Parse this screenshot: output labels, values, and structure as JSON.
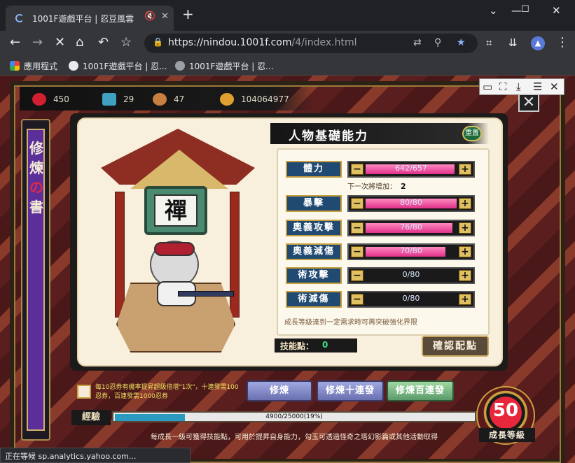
{
  "browser": {
    "tab_title": "1001F遊戲平台 | 忍豆風雲",
    "url_host": "https://nindou.1001f.com",
    "url_path": "/4/index.html",
    "status_text": "正在等候 sp.analytics.yahoo.com...",
    "bookmarks": [
      {
        "label": "應用程式"
      },
      {
        "label": "1001F遊戲平台 | 忍..."
      },
      {
        "label": "1001F遊戲平台 | 忍..."
      }
    ]
  },
  "game": {
    "resources": [
      {
        "icon": "heart-icon",
        "value": "450",
        "color": "#d02030"
      },
      {
        "icon": "card-icon",
        "value": "29",
        "color": "#40a0c0"
      },
      {
        "icon": "bread-icon",
        "value": "47",
        "color": "#c88040"
      },
      {
        "icon": "coin-icon",
        "value": "104064977",
        "color": "#e0a030"
      }
    ],
    "scroll_title": [
      "修",
      "煉",
      "の",
      "書"
    ],
    "shrine_sign": "禪",
    "stats_title": "人物基礎能力",
    "reset_label": "重置",
    "stats": [
      {
        "label": "體力",
        "value": "642/657",
        "fill": 0.977
      },
      {
        "label": "暴擊",
        "value": "80/80",
        "fill": 1.0
      },
      {
        "label": "奧義攻擊",
        "value": "76/80",
        "fill": 0.95
      },
      {
        "label": "奧義減傷",
        "value": "70/80",
        "fill": 0.875
      },
      {
        "label": "術攻擊",
        "value": "0/80",
        "fill": 0
      },
      {
        "label": "術減傷",
        "value": "0/80",
        "fill": 0
      }
    ],
    "next_increase_label": "下一次將增加：",
    "next_increase_value": "2",
    "note": "成長等級達到一定需求時可再突破強化界限",
    "skill_points_label": "技能點：",
    "skill_points_value": "0",
    "confirm_label": "確認配點",
    "promo_text": "每10忍券有機率提昇超級倍增\"1次\"，十連發需100忍券，百連發需1000忍券",
    "train_buttons": [
      "修煉",
      "修煉十連發",
      "修煉百連發"
    ],
    "xp_label": "經驗",
    "xp_text": "4900/25000(19%)",
    "xp_fraction": 0.196,
    "info_text": "每成長一級可獲得技能點，可用於提昇自身能力，勾玉可透過怪奇之塔幻影篇或其他活動取得",
    "level": "50",
    "level_label": "成長等級"
  }
}
